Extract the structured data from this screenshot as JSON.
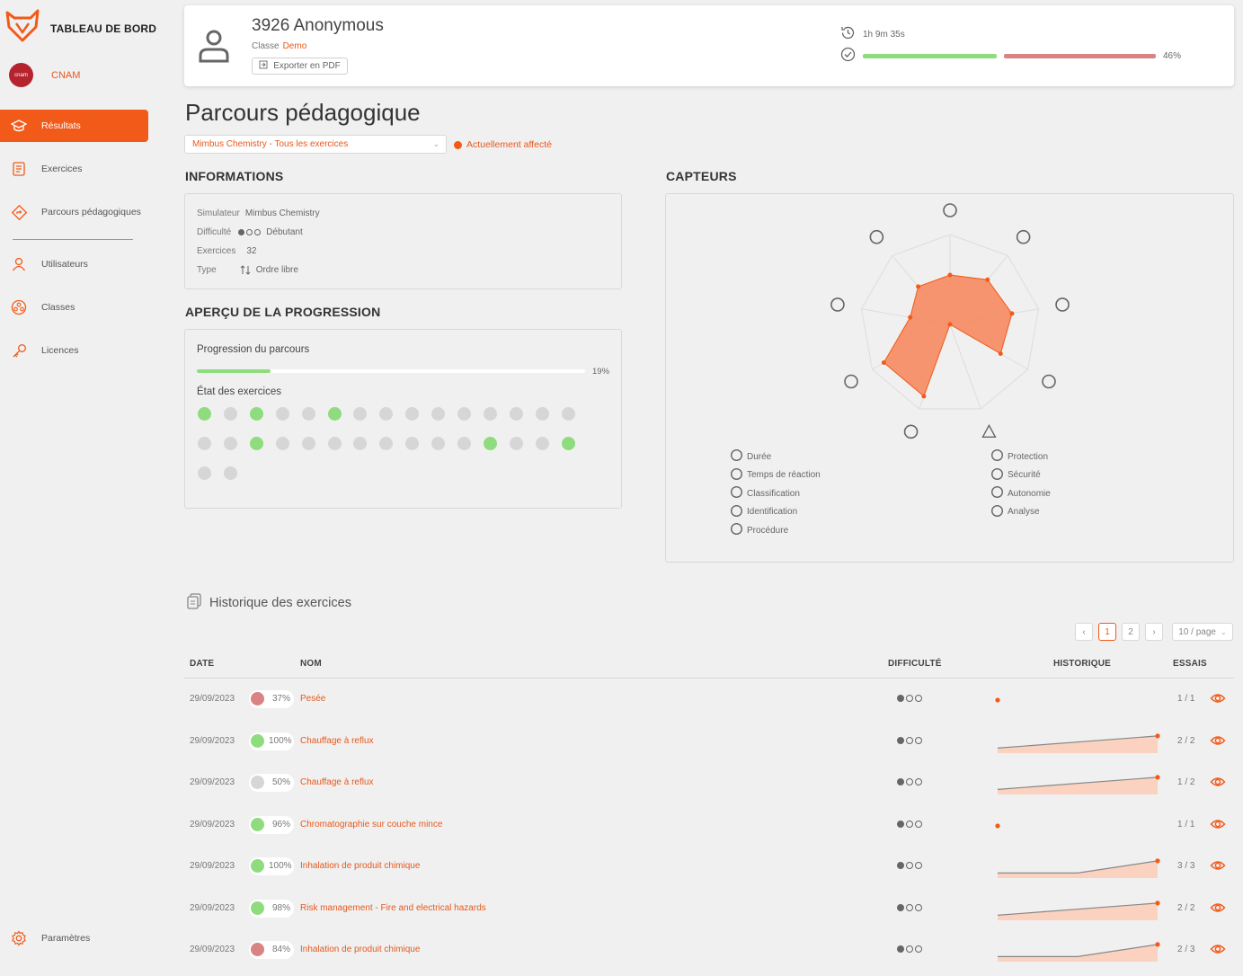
{
  "brand": {
    "title": "TABLEAU DE BORD"
  },
  "org": {
    "name": "CNAM",
    "avatar_text": "cnam"
  },
  "nav": {
    "results": "Résultats",
    "exercises": "Exercices",
    "paths": "Parcours pédagogiques",
    "users": "Utilisateurs",
    "classes": "Classes",
    "licenses": "Licences",
    "settings": "Paramètres"
  },
  "header": {
    "user_name": "3926 Anonymous",
    "class_label": "Classe",
    "class_value": "Demo",
    "export_label": "Exporter en PDF",
    "time": "1h 9m 35s",
    "score_pct": "46%",
    "score_fraction": 0.46
  },
  "page": {
    "title": "Parcours pédagogique",
    "course_select": "Mimbus Chemistry - Tous les exercices",
    "assigned_label": "Actuellement affecté"
  },
  "info": {
    "section_title": "INFORMATIONS",
    "simulator_label": "Simulateur",
    "simulator_value": "Mimbus Chemistry",
    "difficulty_label": "Difficulté",
    "difficulty_value": "Débutant",
    "exercises_label": "Exercices",
    "exercises_value": "32",
    "type_label": "Type",
    "type_value": "Ordre libre"
  },
  "progress": {
    "section_title": "APERÇU DE LA PROGRESSION",
    "title": "Progression du parcours",
    "pct": "19%",
    "fraction": 0.19,
    "state_title": "État des exercices",
    "states": [
      1,
      0,
      1,
      0,
      0,
      1,
      0,
      0,
      0,
      0,
      0,
      0,
      0,
      0,
      0,
      0,
      0,
      1,
      0,
      0,
      0,
      0,
      0,
      0,
      0,
      0,
      1,
      0,
      0,
      1,
      0,
      0
    ]
  },
  "sensors": {
    "section_title": "CAPTEURS",
    "axes": [
      "Durée",
      "Protection",
      "Temps de réaction",
      "Sécurité",
      "Classification",
      "Autonomie",
      "Identification",
      "Analyse",
      "Procédure"
    ],
    "legend_left": [
      "Durée",
      "Temps de réaction",
      "Classification",
      "Identification",
      "Procédure"
    ],
    "legend_right": [
      "Protection",
      "Sécurité",
      "Autonomie",
      "Analyse"
    ],
    "values": [
      0.55,
      0.65,
      0.7,
      0.65,
      0.0,
      0.85,
      0.85,
      0.45,
      0.55
    ]
  },
  "history": {
    "title": "Historique des exercices",
    "pages": [
      "1",
      "2"
    ],
    "page_size": "10 / page",
    "columns": {
      "date": "DATE",
      "name": "NOM",
      "difficulty": "DIFFICULTÉ",
      "history": "HISTORIQUE",
      "tries": "ESSAIS"
    },
    "rows": [
      {
        "date": "29/09/2023",
        "score": "37%",
        "status": "red",
        "name": "Pesée",
        "tries": "1 / 1",
        "spark": [
          0.5
        ]
      },
      {
        "date": "29/09/2023",
        "score": "100%",
        "status": "green",
        "name": "Chauffage à reflux",
        "tries": "2 / 2",
        "spark": [
          0.2,
          0.95
        ]
      },
      {
        "date": "29/09/2023",
        "score": "50%",
        "status": "grey",
        "name": "Chauffage à reflux",
        "tries": "1 / 2",
        "spark": [
          0.2,
          0.95
        ]
      },
      {
        "date": "29/09/2023",
        "score": "96%",
        "status": "green",
        "name": "Chromatographie sur couche mince",
        "tries": "1 / 1",
        "spark": [
          0.5
        ]
      },
      {
        "date": "29/09/2023",
        "score": "100%",
        "status": "green",
        "name": "Inhalation de produit chimique",
        "tries": "3 / 3",
        "spark": [
          0.2,
          0.2,
          0.95
        ]
      },
      {
        "date": "29/09/2023",
        "score": "98%",
        "status": "green",
        "name": "Risk management - Fire and electrical hazards",
        "tries": "2 / 2",
        "spark": [
          0.2,
          0.95
        ]
      },
      {
        "date": "29/09/2023",
        "score": "84%",
        "status": "red",
        "name": "Inhalation de produit chimique",
        "tries": "2 / 3",
        "spark": [
          0.2,
          0.2,
          0.95
        ]
      }
    ]
  },
  "colors": {
    "accent": "#f25a1a",
    "green": "#8fdc7e",
    "red": "#d98385",
    "grey": "#d6d6d6"
  }
}
